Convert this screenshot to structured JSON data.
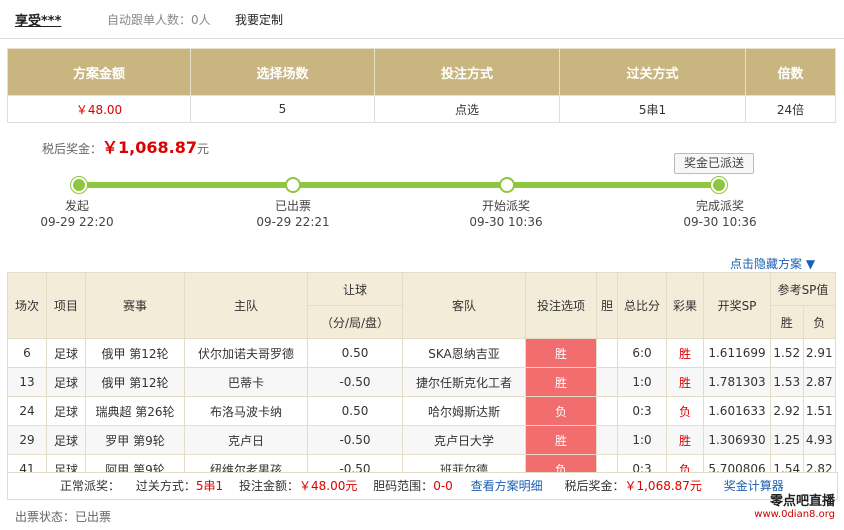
{
  "topbar": {
    "user": "享受***",
    "follow": "自动跟单人数：0人",
    "custom": "我要定制"
  },
  "summary": {
    "headers": [
      "方案金额",
      "选择场数",
      "投注方式",
      "过关方式",
      "倍数"
    ],
    "values": [
      "￥48.00",
      "5",
      "点选",
      "5串1",
      "24倍"
    ]
  },
  "prize": {
    "label": "税后奖金：",
    "amount": "￥1,068.87",
    "unit": "元"
  },
  "sent_button": "奖金已派送",
  "steps": [
    {
      "label": "发起",
      "time": "09-29 22:20"
    },
    {
      "label": "已出票",
      "time": "09-29 22:21"
    },
    {
      "label": "开始派奖",
      "time": "09-30 10:36"
    },
    {
      "label": "完成派奖",
      "time": "09-30 10:36"
    }
  ],
  "hide_link": "点击隐藏方案 ▼",
  "table": {
    "headers": {
      "num": "场次",
      "type": "项目",
      "match": "赛事",
      "home": "主队",
      "handicap": "让球",
      "handicap_sub": "（分/局/盘）",
      "away": "客队",
      "pick": "投注选项",
      "banker": "胆",
      "score": "总比分",
      "result": "彩果",
      "sp": "开奖SP",
      "ref": "参考SP值",
      "win": "胜",
      "lose": "负"
    },
    "rows": [
      {
        "num": "6",
        "type": "足球",
        "match": "俄甲 第12轮",
        "home": "伏尔加诺夫哥罗德",
        "handicap": "0.50",
        "away": "SKA恩纳吉亚",
        "pick": "胜",
        "banker": "",
        "score": "6:0",
        "result": "胜",
        "sp": "1.611699",
        "win": "1.52",
        "lose": "2.91"
      },
      {
        "num": "13",
        "type": "足球",
        "match": "俄甲 第12轮",
        "home": "巴蒂卡",
        "handicap": "-0.50",
        "away": "捷尔任斯克化工者",
        "pick": "胜",
        "banker": "",
        "score": "1:0",
        "result": "胜",
        "sp": "1.781303",
        "win": "1.53",
        "lose": "2.87"
      },
      {
        "num": "24",
        "type": "足球",
        "match": "瑞典超 第26轮",
        "home": "布洛马波卡纳",
        "handicap": "0.50",
        "away": "哈尔姆斯达斯",
        "pick": "负",
        "banker": "",
        "score": "0:3",
        "result": "负",
        "sp": "1.601633",
        "win": "2.92",
        "lose": "1.51"
      },
      {
        "num": "29",
        "type": "足球",
        "match": "罗甲 第9轮",
        "home": "克卢日",
        "handicap": "-0.50",
        "away": "克卢日大学",
        "pick": "胜",
        "banker": "",
        "score": "1:0",
        "result": "胜",
        "sp": "1.306930",
        "win": "1.25",
        "lose": "4.93"
      },
      {
        "num": "41",
        "type": "足球",
        "match": "阿甲 第9轮",
        "home": "纽维尔老男孩",
        "handicap": "-0.50",
        "away": "班菲尔德",
        "pick": "负",
        "banker": "",
        "score": "0:3",
        "result": "负",
        "sp": "5.700806",
        "win": "1.54",
        "lose": "2.82"
      }
    ]
  },
  "footer": {
    "normal": "正常派奖：",
    "pass_label": "过关方式：",
    "pass_val": "5串1",
    "amount_label": "投注金额：",
    "amount_val": "￥48.00元",
    "range_label": "胆码范围：",
    "range_val": "0-0",
    "view_link": "查看方案明细",
    "prize_label": "税后奖金：",
    "prize_val": "￥1,068.87元",
    "calc_link": "奖金计算器"
  },
  "status": "出票状态：已出票",
  "watermark": {
    "line1": "零点吧直播",
    "line2": "www.0dian8.org"
  }
}
